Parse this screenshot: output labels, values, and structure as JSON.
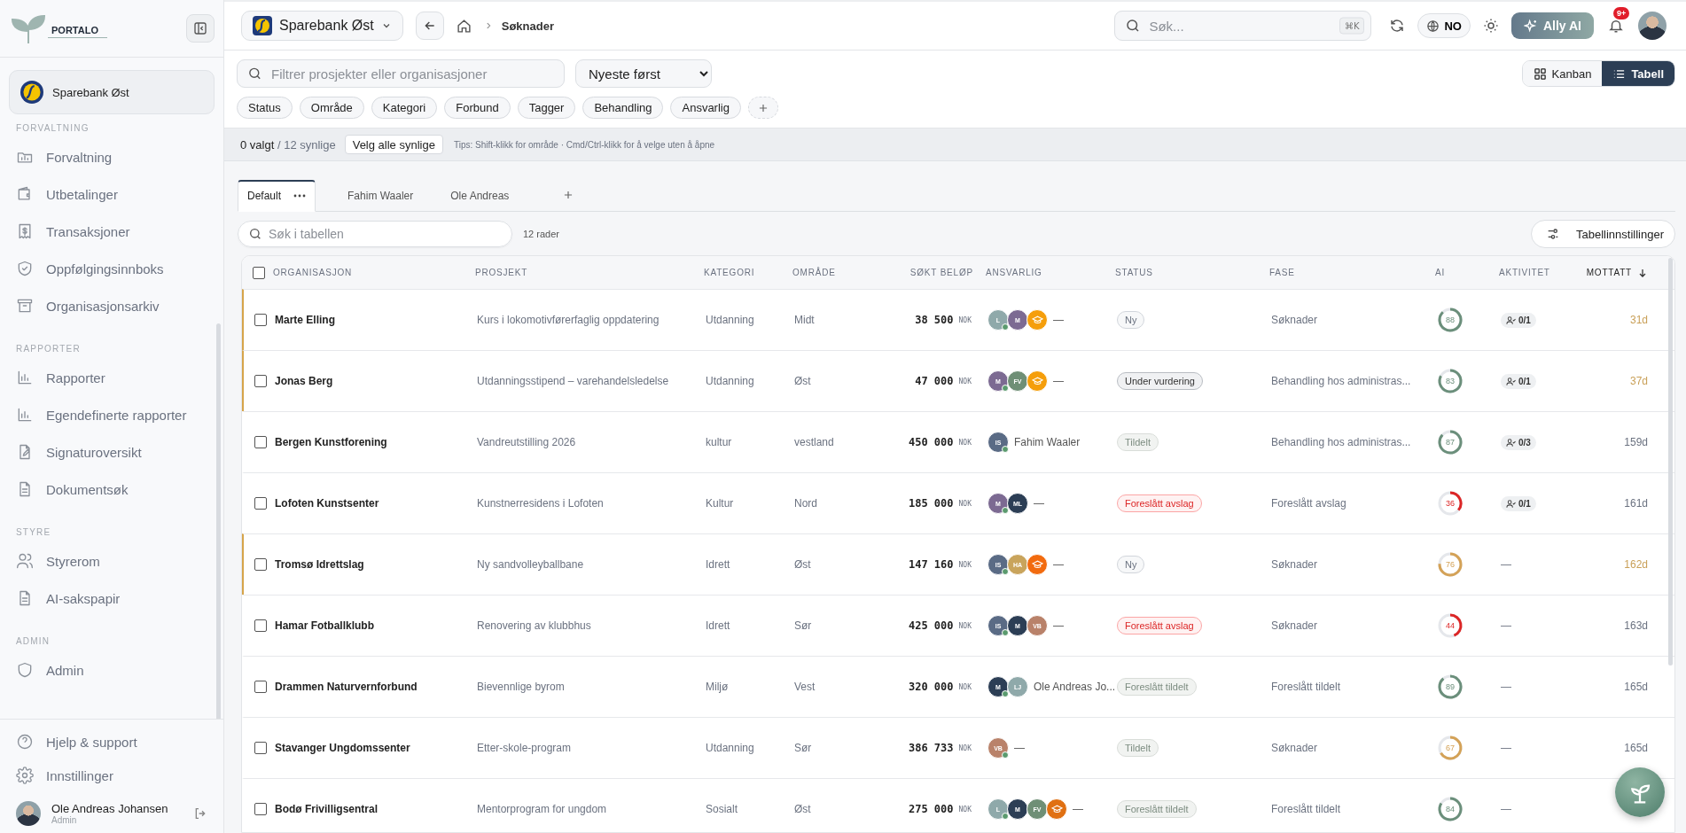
{
  "sidebar": {
    "logo_text": "PORTALO",
    "organization": "Sparebank Øst",
    "sections": [
      {
        "title": "FORVALTNING",
        "items": [
          {
            "label": "Forvaltning"
          },
          {
            "label": "Utbetalinger"
          },
          {
            "label": "Transaksjoner"
          },
          {
            "label": "Oppfølgingsinnboks"
          },
          {
            "label": "Organisasjonsarkiv"
          }
        ]
      },
      {
        "title": "RAPPORTER",
        "items": [
          {
            "label": "Rapporter"
          },
          {
            "label": "Egendefinerte rapporter"
          },
          {
            "label": "Signaturoversikt"
          },
          {
            "label": "Dokumentsøk"
          }
        ]
      },
      {
        "title": "STYRE",
        "items": [
          {
            "label": "Styrerom"
          },
          {
            "label": "AI-sakspapir"
          }
        ]
      },
      {
        "title": "ADMIN",
        "items": [
          {
            "label": "Admin"
          }
        ]
      }
    ],
    "footer_items": [
      {
        "label": "Hjelp & support"
      },
      {
        "label": "Innstillinger"
      }
    ],
    "user": {
      "name": "Ole Andreas Johansen",
      "role": "Admin"
    }
  },
  "topbar": {
    "organization": "Sparebank Øst",
    "breadcrumb": "Søknader",
    "search": {
      "placeholder": "Søk...",
      "shortcut": "⌘K"
    },
    "language": "NO",
    "ai_button": "Ally AI",
    "notifications": "9+"
  },
  "filters": {
    "search": {
      "placeholder": "Filtrer prosjekter eller organisasjoner"
    },
    "sort": "Nyeste først",
    "views": [
      {
        "label": "Kanban",
        "selected": false
      },
      {
        "label": "Tabell",
        "selected": true
      }
    ],
    "chips": [
      "Status",
      "Område",
      "Kategori",
      "Forbund",
      "Tagger",
      "Behandling",
      "Ansvarlig"
    ]
  },
  "selection": {
    "selected": "0 valgt",
    "visible": "/ 12 synlige",
    "select_all": "Velg alle synlige",
    "tip": "Tips: Shift-klikk for område · Cmd/Ctrl-klikk for å velge uten å åpne"
  },
  "saved_views": [
    {
      "label": "Default",
      "selected": true
    },
    {
      "label": "Fahim Waaler",
      "selected": false
    },
    {
      "label": "Ole Andreas",
      "selected": false
    }
  ],
  "table_search": {
    "placeholder": "Søk i tabellen"
  },
  "row_count": "12 rader",
  "settings_button": "Tabellinnstillinger",
  "table": {
    "all_checked": false,
    "columns": [
      "ORGANISASJON",
      "PROSJEKT",
      "KATEGORI",
      "OMRÅDE",
      "SØKT BELØP",
      "ANSVARLIG",
      "STATUS",
      "FASE",
      "AI",
      "AKTIVITET",
      "MOTTATT"
    ],
    "rows": [
      {
        "checked": false,
        "flagged": true,
        "organisasjon": "Marte Elling",
        "prosjekt": "Kurs i lokomotivførerfaglig oppdatering",
        "kategori": "Utdanning",
        "omrade": "Midt",
        "amount": "38 500",
        "currency": "NOK",
        "assignees": [
          {
            "kind": "initials",
            "initials": "L",
            "color": "#8fa9aa",
            "online": true
          },
          {
            "kind": "initials",
            "initials": "M",
            "color": "#7c6a92",
            "online": false
          },
          {
            "kind": "icon",
            "color": "#f59e0b",
            "online": false
          }
        ],
        "assignee_name": "—",
        "status": {
          "label": "Ny",
          "kind": "neutral"
        },
        "fase": "Søknader",
        "ai": {
          "score": "88",
          "color": "#6b8f7b"
        },
        "activity": {
          "kind": "tasks",
          "text": "0/1"
        },
        "mottatt": "31d"
      },
      {
        "checked": false,
        "flagged": true,
        "organisasjon": "Jonas Berg",
        "prosjekt": "Utdanningsstipend – varehandelsledelse",
        "kategori": "Utdanning",
        "omrade": "Øst",
        "amount": "47 000",
        "currency": "NOK",
        "assignees": [
          {
            "kind": "initials",
            "initials": "M",
            "color": "#7c6a92",
            "online": true
          },
          {
            "kind": "initials",
            "initials": "FV",
            "color": "#6f8f76",
            "online": false
          },
          {
            "kind": "icon",
            "color": "#f59e0b",
            "online": false
          }
        ],
        "assignee_name": "—",
        "status": {
          "label": "Under vurdering",
          "kind": "strong"
        },
        "fase": "Behandling hos administras...",
        "ai": {
          "score": "83",
          "color": "#6b8f7b"
        },
        "activity": {
          "kind": "tasks",
          "text": "0/1"
        },
        "mottatt": "37d"
      },
      {
        "checked": false,
        "flagged": false,
        "organisasjon": "Bergen Kunstforening",
        "prosjekt": "Vandreutstilling 2026",
        "kategori": "kultur",
        "omrade": "vestland",
        "amount": "450 000",
        "currency": "NOK",
        "assignees": [
          {
            "kind": "initials",
            "initials": "IS",
            "color": "#5a6b85",
            "online": true
          }
        ],
        "assignee_name": "Fahim Waaler",
        "status": {
          "label": "Tildelt",
          "kind": "muted"
        },
        "fase": "Behandling hos administras...",
        "ai": {
          "score": "87",
          "color": "#6b8f7b"
        },
        "activity": {
          "kind": "tasks",
          "text": "0/3"
        },
        "mottatt": "159d"
      },
      {
        "checked": false,
        "flagged": false,
        "organisasjon": "Lofoten Kunstsenter",
        "prosjekt": "Kunstnerresidens i Lofoten",
        "kategori": "Kultur",
        "omrade": "Nord",
        "amount": "185 000",
        "currency": "NOK",
        "assignees": [
          {
            "kind": "initials",
            "initials": "M",
            "color": "#7c6a92",
            "online": true
          },
          {
            "kind": "initials",
            "initials": "ML",
            "color": "#2c3e55",
            "online": false
          }
        ],
        "assignee_name": "—",
        "status": {
          "label": "Foreslått avslag",
          "kind": "danger"
        },
        "fase": "Foreslått avslag",
        "ai": {
          "score": "36",
          "color": "#dc2626"
        },
        "activity": {
          "kind": "tasks",
          "text": "0/1"
        },
        "mottatt": "161d"
      },
      {
        "checked": false,
        "flagged": true,
        "organisasjon": "Tromsø Idrettslag",
        "prosjekt": "Ny sandvolleyballbane",
        "kategori": "Idrett",
        "omrade": "Øst",
        "amount": "147 160",
        "currency": "NOK",
        "assignees": [
          {
            "kind": "initials",
            "initials": "IS",
            "color": "#5a6b85",
            "online": true
          },
          {
            "kind": "initials",
            "initials": "HA",
            "color": "#c9a45c",
            "online": false
          },
          {
            "kind": "icon",
            "color": "#f26b0f",
            "online": false
          }
        ],
        "assignee_name": "—",
        "status": {
          "label": "Ny",
          "kind": "neutral"
        },
        "fase": "Søknader",
        "ai": {
          "score": "76",
          "color": "#d4a257"
        },
        "activity": {
          "kind": "none",
          "text": "—"
        },
        "mottatt": "162d"
      },
      {
        "checked": false,
        "flagged": false,
        "organisasjon": "Hamar Fotballklubb",
        "prosjekt": "Renovering av klubbhus",
        "kategori": "Idrett",
        "omrade": "Sør",
        "amount": "425 000",
        "currency": "NOK",
        "assignees": [
          {
            "kind": "initials",
            "initials": "IS",
            "color": "#5a6b85",
            "online": true
          },
          {
            "kind": "initials",
            "initials": "M",
            "color": "#2c3e55",
            "online": false
          },
          {
            "kind": "initials",
            "initials": "VB",
            "color": "#b9826a",
            "online": false
          }
        ],
        "assignee_name": "—",
        "status": {
          "label": "Foreslått avslag",
          "kind": "danger"
        },
        "fase": "Søknader",
        "ai": {
          "score": "44",
          "color": "#dc2626"
        },
        "activity": {
          "kind": "none",
          "text": "—"
        },
        "mottatt": "163d"
      },
      {
        "checked": false,
        "flagged": false,
        "organisasjon": "Drammen Naturvernforbund",
        "prosjekt": "Bievennlige byrom",
        "kategori": "Miljø",
        "omrade": "Vest",
        "amount": "320 000",
        "currency": "NOK",
        "assignees": [
          {
            "kind": "initials",
            "initials": "M",
            "color": "#2c3e55",
            "online": true
          },
          {
            "kind": "initials",
            "initials": "LJ",
            "color": "#8fa9aa",
            "online": false
          }
        ],
        "assignee_name": "Ole Andreas Jo...",
        "status": {
          "label": "Foreslått tildelt",
          "kind": "muted"
        },
        "fase": "Foreslått tildelt",
        "ai": {
          "score": "89",
          "color": "#6b8f7b"
        },
        "activity": {
          "kind": "none",
          "text": "—"
        },
        "mottatt": "165d"
      },
      {
        "checked": false,
        "flagged": false,
        "organisasjon": "Stavanger Ungdomssenter",
        "prosjekt": "Etter-skole-program",
        "kategori": "Utdanning",
        "omrade": "Sør",
        "amount": "386 733",
        "currency": "NOK",
        "assignees": [
          {
            "kind": "initials",
            "initials": "VB",
            "color": "#b9826a",
            "online": true
          }
        ],
        "assignee_name": "—",
        "status": {
          "label": "Tildelt",
          "kind": "muted"
        },
        "fase": "Søknader",
        "ai": {
          "score": "67",
          "color": "#d4a257"
        },
        "activity": {
          "kind": "none",
          "text": "—"
        },
        "mottatt": "165d"
      },
      {
        "checked": false,
        "flagged": false,
        "organisasjon": "Bodø Frivilligsentral",
        "prosjekt": "Mentorprogram for ungdom",
        "kategori": "Sosialt",
        "omrade": "Øst",
        "amount": "275 000",
        "currency": "NOK",
        "assignees": [
          {
            "kind": "initials",
            "initials": "L",
            "color": "#8fa9aa",
            "online": true
          },
          {
            "kind": "initials",
            "initials": "M",
            "color": "#2c3e55",
            "online": false
          },
          {
            "kind": "initials",
            "initials": "FV",
            "color": "#6f8f76",
            "online": false
          },
          {
            "kind": "icon",
            "color": "#e07012",
            "online": false
          }
        ],
        "assignee_name": "—",
        "status": {
          "label": "Foreslått tildelt",
          "kind": "muted"
        },
        "fase": "Foreslått tildelt",
        "ai": {
          "score": "84",
          "color": "#6b8f7b"
        },
        "activity": {
          "kind": "none",
          "text": "—"
        }
      }
    ]
  }
}
